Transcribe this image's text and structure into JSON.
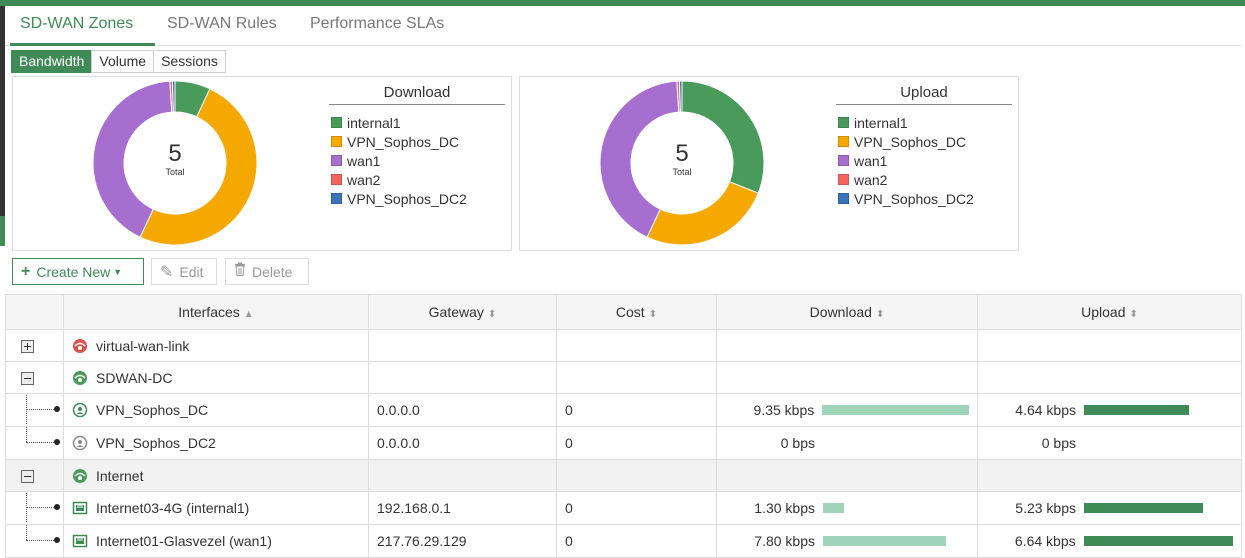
{
  "tabs": [
    {
      "label": "SD-WAN Zones"
    },
    {
      "label": "SD-WAN Rules"
    },
    {
      "label": "Performance SLAs"
    }
  ],
  "view_toggle": {
    "bandwidth": "Bandwidth",
    "volume": "Volume",
    "sessions": "Sessions",
    "selected": "Bandwidth"
  },
  "download_chart": {
    "title": "Download",
    "center_value": "5",
    "center_label": "Total"
  },
  "upload_chart": {
    "title": "Upload",
    "center_value": "5",
    "center_label": "Total"
  },
  "legend": [
    {
      "label": "internal1",
      "color": "#4a9a5c"
    },
    {
      "label": "VPN_Sophos_DC",
      "color": "#f5a800"
    },
    {
      "label": "wan1",
      "color": "#a66ecf"
    },
    {
      "label": "wan2",
      "color": "#f2655e"
    },
    {
      "label": "VPN_Sophos_DC2",
      "color": "#3a73b8"
    }
  ],
  "chart_data": [
    {
      "type": "pie",
      "title": "Download",
      "center_text": "5 Total",
      "categories": [
        "internal1",
        "VPN_Sophos_DC",
        "wan1",
        "wan2",
        "VPN_Sophos_DC2"
      ],
      "values": [
        7,
        50,
        42,
        0.5,
        0.5
      ]
    },
    {
      "type": "pie",
      "title": "Upload",
      "center_text": "5 Total",
      "categories": [
        "internal1",
        "VPN_Sophos_DC",
        "wan1",
        "wan2",
        "VPN_Sophos_DC2"
      ],
      "values": [
        31,
        26,
        42,
        0.5,
        0.5
      ]
    }
  ],
  "toolbar": {
    "create_new": "Create New",
    "edit": "Edit",
    "delete": "Delete"
  },
  "table": {
    "headers": {
      "interfaces": "Interfaces",
      "gateway": "Gateway",
      "cost": "Cost",
      "download": "Download",
      "upload": "Upload"
    },
    "rows": [
      {
        "name": "virtual-wan-link",
        "gateway": "",
        "cost": "",
        "download": "",
        "upload": ""
      },
      {
        "name": "SDWAN-DC",
        "gateway": "",
        "cost": "",
        "download": "",
        "upload": ""
      },
      {
        "name": "VPN_Sophos_DC",
        "gateway": "0.0.0.0",
        "cost": "0",
        "download": "9.35 kbps",
        "upload": "4.64 kbps",
        "download_fraction": 1.0,
        "upload_fraction": 0.7
      },
      {
        "name": "VPN_Sophos_DC2",
        "gateway": "0.0.0.0",
        "cost": "0",
        "download": "0 bps",
        "upload": "0 bps",
        "download_fraction": 0,
        "upload_fraction": 0
      },
      {
        "name": "Internet",
        "gateway": "",
        "cost": "",
        "download": "",
        "upload": ""
      },
      {
        "name": "Internet03-4G (internal1)",
        "gateway": "192.168.0.1",
        "cost": "0",
        "download": "1.30 kbps",
        "upload": "5.23 kbps",
        "download_fraction": 0.14,
        "upload_fraction": 0.79
      },
      {
        "name": "Internet01-Glasvezel (wan1)",
        "gateway": "217.76.29.129",
        "cost": "0",
        "download": "7.80 kbps",
        "upload": "6.64 kbps",
        "download_fraction": 0.83,
        "upload_fraction": 1.0
      }
    ]
  },
  "colors": {
    "accent": "#3f8a57",
    "download_bar": "#9fd4b8",
    "upload_bar": "#3f8a57"
  }
}
